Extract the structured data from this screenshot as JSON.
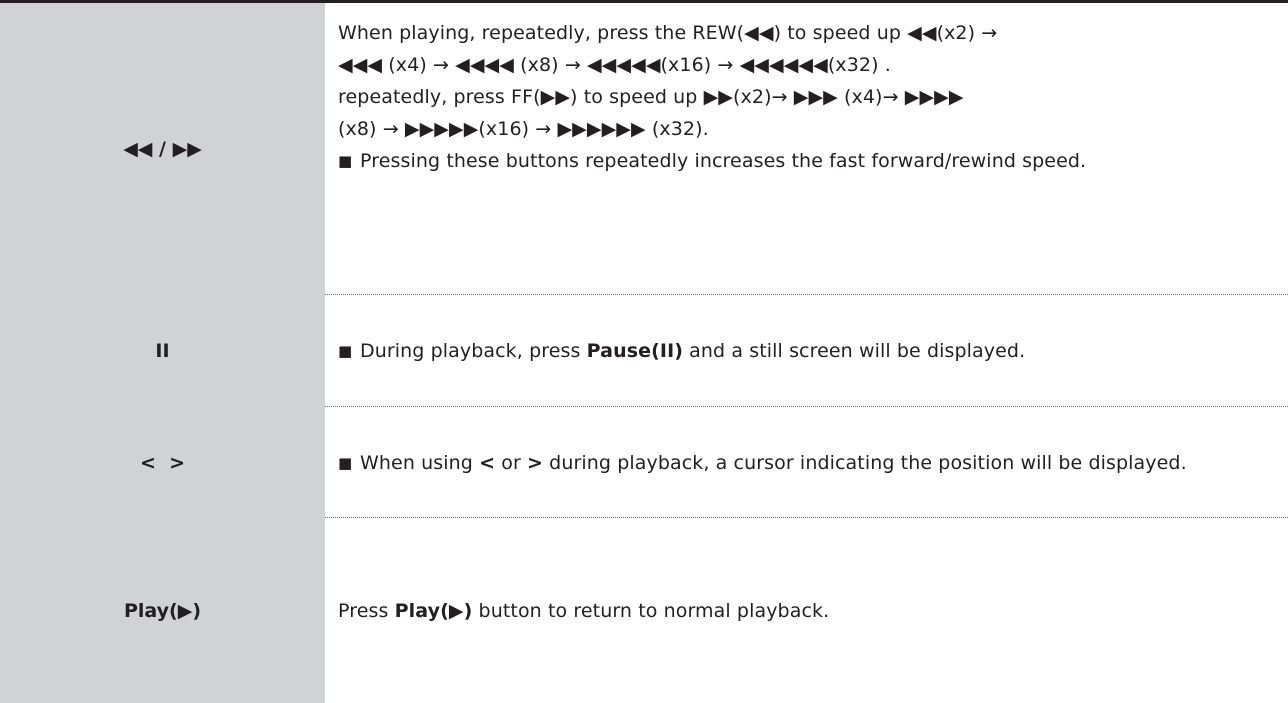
{
  "rows": [
    {
      "key": "◀◀ / ▶▶",
      "lines": {
        "rew_1": "When playing,  repeatedly, press the REW(◀◀) to speed up ◀◀(x2) →",
        "rew_2": "◀◀◀ (x4) → ◀◀◀◀ (x8) → ◀◀◀◀◀(x16) → ◀◀◀◀◀◀(x32) .",
        "ff_1": "repeatedly, press FF(▶▶) to speed up ▶▶(x2)→ ▶▶▶ (x4)→ ▶▶▶▶",
        "ff_2": "(x8) → ▶▶▶▶▶(x16) → ▶▶▶▶▶▶ (x32)."
      },
      "bullet": "Pressing these buttons repeatedly increases the fast forward/rewind speed."
    },
    {
      "key": "II",
      "bullet_pre": "During playback, press ",
      "bullet_bold": "Pause(II)",
      "bullet_post": " and a still screen will be displayed."
    },
    {
      "key": "<  >",
      "bullet_pre": "When using ",
      "bullet_bold_1": "<",
      "bullet_mid": " or ",
      "bullet_bold_2": ">",
      "bullet_post": " during playback, a cursor indicating the position will be displayed."
    },
    {
      "key": "Play(▶)",
      "text_pre": "Press ",
      "text_bold": "Play(▶)",
      "text_post": " button to return to normal playback."
    }
  ],
  "bullet_glyph": "■"
}
